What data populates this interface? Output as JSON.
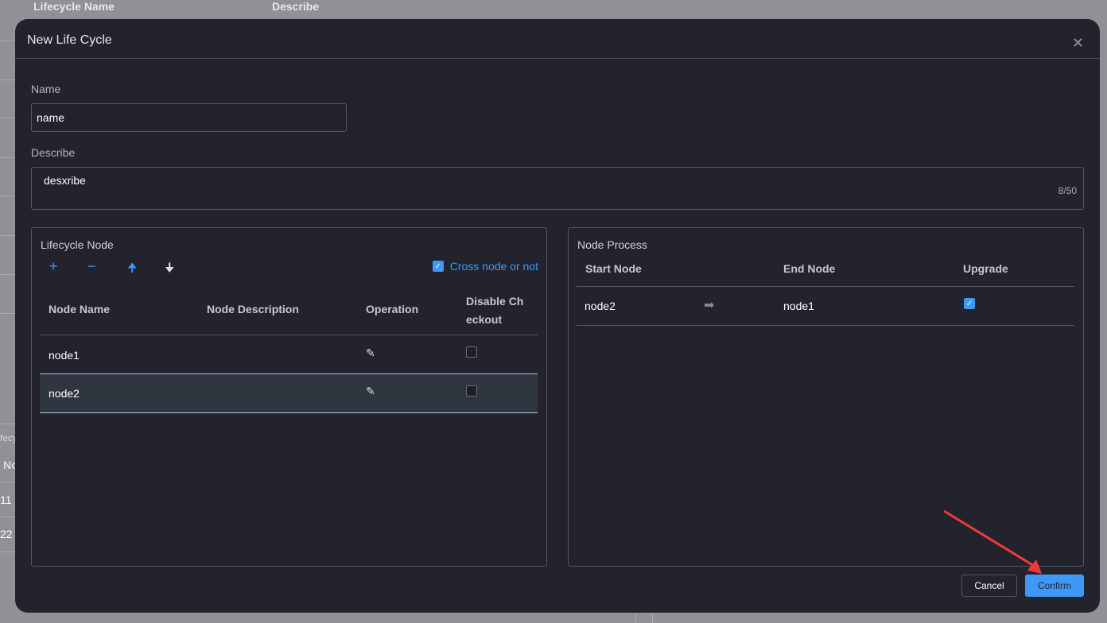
{
  "background": {
    "headers": [
      "Lifecycle Name",
      "Describe"
    ],
    "fragments": [
      "fecy",
      "No",
      "11",
      "22"
    ]
  },
  "modal": {
    "title": "New Life Cycle",
    "close_icon": "close-icon",
    "name_label": "Name",
    "name_value": "name",
    "describe_label": "Describe",
    "describe_value": "desxribe",
    "describe_count": "8/50",
    "lifecycle_node": {
      "title": "Lifecycle Node",
      "tools": [
        "plus-icon",
        "minus-icon",
        "arrow-up-icon",
        "arrow-down-icon"
      ],
      "cross_node_label": "Cross node or not",
      "cross_node_checked": true,
      "columns": [
        "Node Name",
        "Node Description",
        "Operation",
        "Disable Ch eckout"
      ],
      "rows": [
        {
          "name": "node1",
          "description": "",
          "disabled": false
        },
        {
          "name": "node2",
          "description": "",
          "disabled": false,
          "selected": true
        }
      ]
    },
    "node_process": {
      "title": "Node Process",
      "columns": [
        "Start Node",
        "End Node",
        "Upgrade"
      ],
      "rows": [
        {
          "start": "node2",
          "end": "node1",
          "upgrade": true
        }
      ]
    },
    "cancel_label": "Cancel",
    "confirm_label": "Confirm",
    "accent": "#3f98f5"
  }
}
